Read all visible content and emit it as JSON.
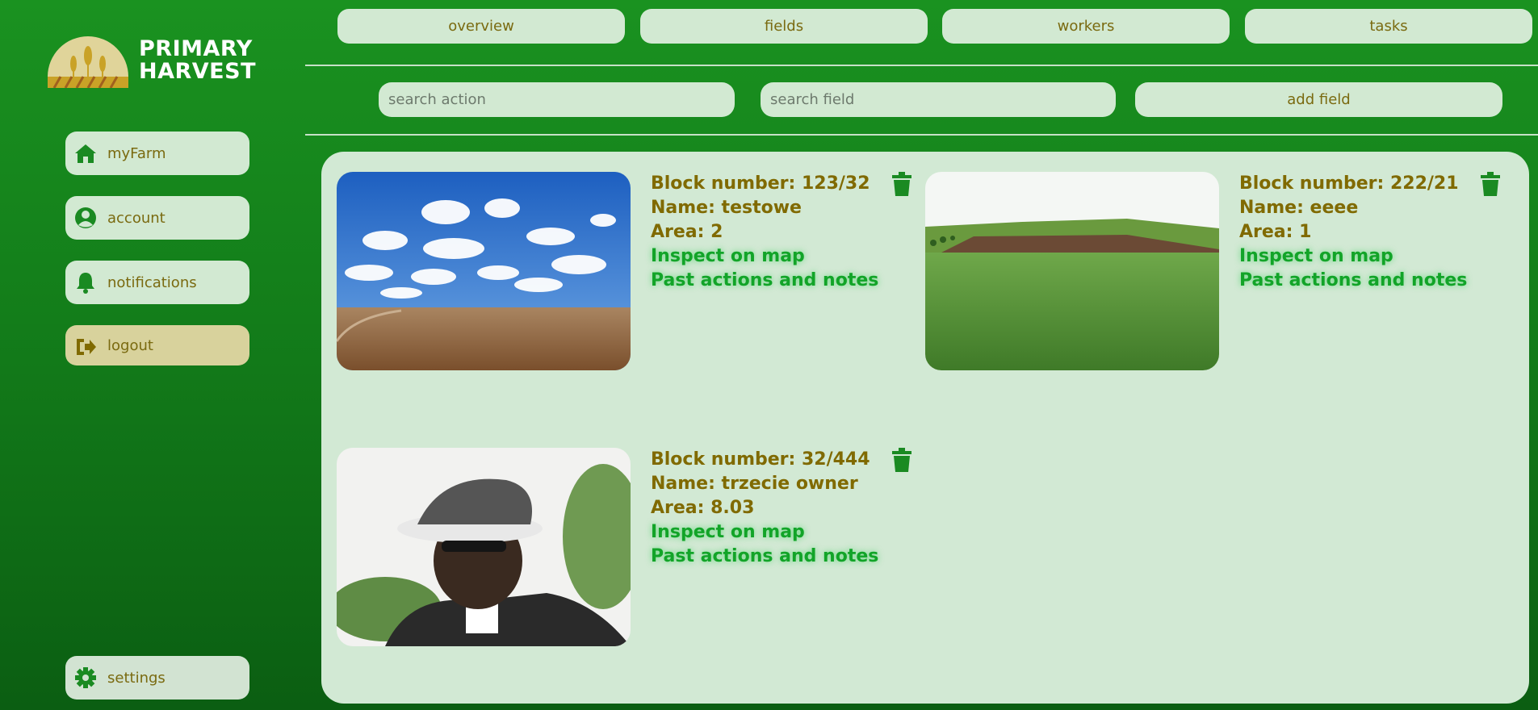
{
  "brand": {
    "line1": "PRIMARY",
    "line2": "HARVEST"
  },
  "sidebar": {
    "items": [
      {
        "label": "myFarm",
        "icon": "home-icon"
      },
      {
        "label": "account",
        "icon": "user-circle-icon"
      },
      {
        "label": "notifications",
        "icon": "bell-icon"
      },
      {
        "label": "logout",
        "icon": "sign-out-icon"
      }
    ],
    "settings": {
      "label": "settings",
      "icon": "gear-icon"
    }
  },
  "nav": {
    "tabs": [
      "overview",
      "fields",
      "workers",
      "tasks"
    ]
  },
  "toolbar": {
    "search_action_placeholder": "search action",
    "search_field_placeholder": "search field",
    "add_field_label": "add field"
  },
  "fields": [
    {
      "block": "Block number: 123/32",
      "name": "Name: testowe",
      "area": "Area: 2",
      "inspect": "Inspect on map",
      "past": "Past actions and notes",
      "image": "sky-wheat-field-photo"
    },
    {
      "block": "Block number: 222/21",
      "name": "Name: eeee",
      "area": "Area: 1",
      "inspect": "Inspect on map",
      "past": "Past actions and notes",
      "image": "green-field-photo"
    },
    {
      "block": "Block number: 32/444",
      "name": "Name: trzecie owner",
      "area": "Area: 8.03",
      "inspect": "Inspect on map",
      "past": "Past actions and notes",
      "image": "man-in-hat-photo"
    }
  ],
  "colors": {
    "background": "#158a1c",
    "panel": "#d2e9d4",
    "meta_text": "#806a00",
    "link": "#12a428",
    "accent_icon": "#1a8a22"
  }
}
